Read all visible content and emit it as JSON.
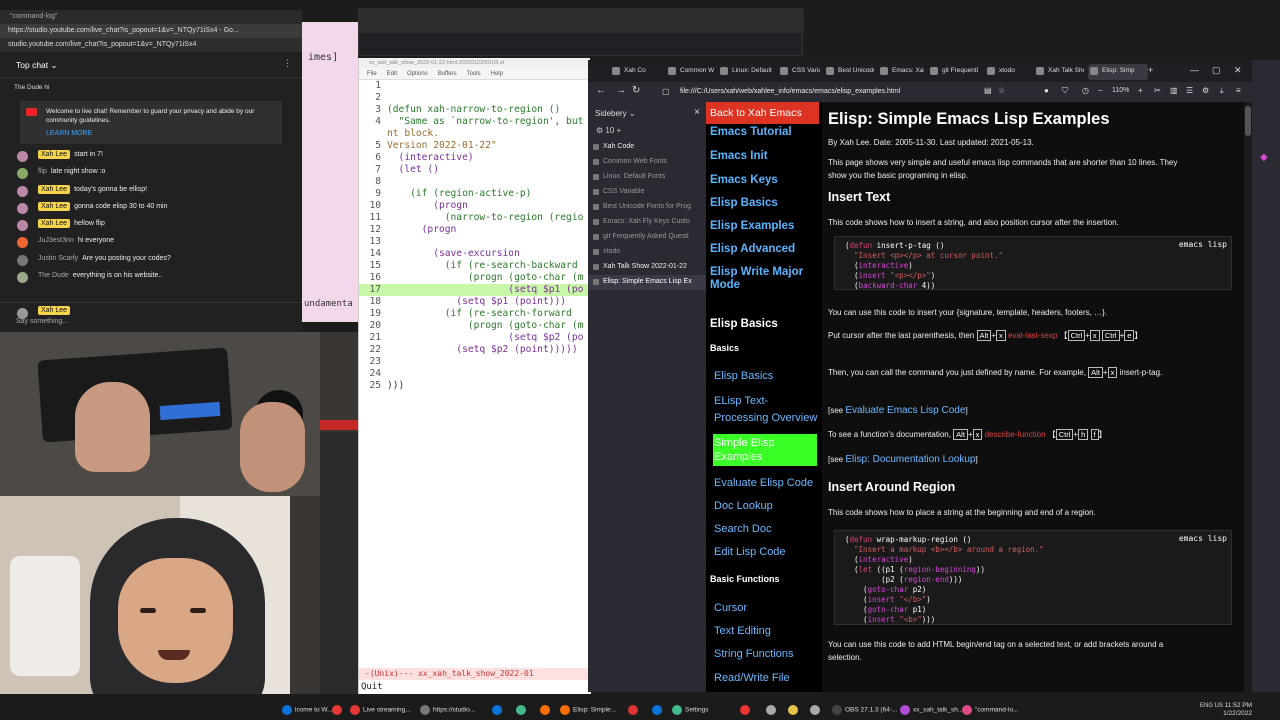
{
  "chat": {
    "window_title": "\"command-log\"",
    "url": "studio.youtube.com/live_chat?is_popout=1&v=_NTQy71iSx4",
    "url_full": "https://studio.youtube.com/live_chat?is_popout=1&v=_NTQy71iSx4 - Go...",
    "header": "Top chat",
    "pinned_name": "The Dude",
    "pinned_text": "hi",
    "welcome_text": "Welcome to live chat! Remember to guard your privacy and abide by our community guidelines.",
    "learn_more": "LEARN MORE",
    "messages": [
      {
        "name": "Xah Lee",
        "owner": true,
        "text": "start in 7!",
        "color": "#b8a"
      },
      {
        "name": "flip",
        "owner": false,
        "text": "late night show :o",
        "color": "#8a6"
      },
      {
        "name": "Xah Lee",
        "owner": true,
        "text": "today's gonna be ellisp!",
        "color": "#b8a"
      },
      {
        "name": "Xah Lee",
        "owner": true,
        "text": "gonna code elisp 30 to 40 min",
        "color": "#b8a"
      },
      {
        "name": "Xah Lee",
        "owner": true,
        "text": "hellow flip",
        "color": "#b8a"
      },
      {
        "name": "JuJ3est3nn",
        "owner": false,
        "text": "hi everyone",
        "color": "#e63"
      },
      {
        "name": "Justin Scarfy",
        "owner": false,
        "text": "Are you posting your codes?",
        "color": "#777"
      },
      {
        "name": "The Dude",
        "owner": false,
        "text": "everything is on his website..",
        "color": "#9a8"
      }
    ],
    "input_name": "Xah Lee",
    "input_placeholder": "Say something..."
  },
  "pink_window": {
    "text_top": "imes]",
    "text_bottom": "undamenta"
  },
  "emacs": {
    "title": "xx_xah_talk_show_2022-01-22.html:2022012200103.el",
    "menu": [
      "File",
      "Edit",
      "Options",
      "Buffers",
      "Tools",
      "Help"
    ],
    "lines": [
      {
        "n": "1",
        "t": ""
      },
      {
        "n": "2",
        "t": ""
      },
      {
        "n": "3",
        "t": "(defun xah-narrow-to-region ()"
      },
      {
        "n": "4",
        "t": "  \"Same as `narrow-to-region', but"
      },
      {
        "n": "",
        "t": "nt block."
      },
      {
        "n": "5",
        "t": "Version 2022-01-22\""
      },
      {
        "n": "6",
        "t": "  (interactive)"
      },
      {
        "n": "7",
        "t": "  (let ()"
      },
      {
        "n": "8",
        "t": ""
      },
      {
        "n": "9",
        "t": "    (if (region-active-p)"
      },
      {
        "n": "10",
        "t": "        (progn"
      },
      {
        "n": "11",
        "t": "          (narrow-to-region (regio"
      },
      {
        "n": "12",
        "t": "      (progn"
      },
      {
        "n": "13",
        "t": ""
      },
      {
        "n": "14",
        "t": "        (save-excursion"
      },
      {
        "n": "15",
        "t": "          (if (re-search-backward"
      },
      {
        "n": "16",
        "t": "              (progn (goto-char (m"
      },
      {
        "n": "17",
        "t": "                     (setq $p1 (po"
      },
      {
        "n": "18",
        "t": "            (setq $p1 (point)))"
      },
      {
        "n": "19",
        "t": "          (if (re-search-forward"
      },
      {
        "n": "20",
        "t": "              (progn (goto-char (m"
      },
      {
        "n": "21",
        "t": "                     (setq $p2 (po"
      },
      {
        "n": "22",
        "t": "            (setq $p2 (point)))))"
      },
      {
        "n": "23",
        "t": ""
      },
      {
        "n": "24",
        "t": ""
      },
      {
        "n": "25",
        "t": ")))"
      }
    ],
    "modeline": "-(Unix)---  xx_xah_talk_show_2022-01",
    "minibuffer": "Quit"
  },
  "firefox": {
    "tabs": [
      "Xah Co",
      "Common We",
      "Linux: Default",
      "CSS Variable",
      "Best Unicode",
      "Emacs: Xah Fi",
      "git Frequentl",
      "xtodo",
      "Xah Talk Show",
      "Elisp: Simp"
    ],
    "new_tab": "+",
    "url": "file:///C:/Users/xah/web/xahlee_info/emacs/emacs/elisp_examples.html",
    "zoom": "110%",
    "sidebery_title": "Sidebery",
    "sidebery_items": [
      {
        "label": "Xah Code",
        "state": "hi"
      },
      {
        "label": "Common Web Fonts",
        "state": ""
      },
      {
        "label": "Linux: Default Fonts",
        "state": ""
      },
      {
        "label": "CSS Variable",
        "state": ""
      },
      {
        "label": "Best Unicode Fonts for Prog",
        "state": ""
      },
      {
        "label": "Emacs: Xah Fly Keys Custo",
        "state": ""
      },
      {
        "label": "git Frequently Asked Questi",
        "state": ""
      },
      {
        "label": "xtodo",
        "state": ""
      },
      {
        "label": "Xah Talk Show 2022-01-22",
        "state": "hi"
      },
      {
        "label": "Elisp: Simple Emacs Lisp Ex",
        "state": "act"
      }
    ]
  },
  "page": {
    "back_button": "Back to Xah Emacs",
    "nav_main": [
      "Emacs Tutorial",
      "Emacs Init",
      "Emacs Keys",
      "Elisp Basics",
      "Elisp Examples",
      "Elisp Advanced",
      "Elisp Write Major Mode"
    ],
    "nav_section": "Elisp Basics",
    "nav_sub1": "Basics",
    "nav_basics": [
      "Elisp Basics",
      "ELisp Text-Processing Overview",
      "Simple Elisp Examples",
      "Evaluate Elisp Code",
      "Doc Lookup",
      "Search Doc",
      "Edit Lisp Code"
    ],
    "nav_sub2": "Basic Functions",
    "nav_funcs": [
      "Cursor",
      "Text Editing",
      "String Functions",
      "Read/Write File"
    ],
    "title": "Elisp: Simple Emacs Lisp Examples",
    "byline": "By Xah Lee. Date: 2005-11-30. Last updated: 2021-05-13.",
    "intro": "This page shows very simple and useful emacs lisp commands that are shorter than 10 lines. They show you the basic programing in elisp.",
    "h_insert_text": "Insert Text",
    "p_insert_text": "This code shows how to insert a string, and also position cursor after the insertion.",
    "code_lang": "emacs lisp",
    "p_use": "You can use this code to insert your {signature, template, headers, footers, …}.",
    "p_cursor": "Put cursor after the last parenthesis, then",
    "k_alt": "Alt",
    "k_x": "x",
    "cmd_eval": "eval-last-sexp",
    "k_ctrl": "Ctrl",
    "k_e": "e",
    "p_then": "Then, you can call the command you just defined by name. For example,",
    "cmd_insert": "insert-p-tag.",
    "see1_pre": "[see",
    "see1_link": "Evaluate Emacs Lisp Code",
    "see_post": "]",
    "p_doc": "To see a function's documentation,",
    "cmd_describe": "describe-function",
    "k_h": "h",
    "k_f": "f",
    "see2_link": "Elisp: Documentation Lookup",
    "h_insert_around": "Insert Around Region",
    "p_around": "This code shows how to place a string at the beginning and end of a region.",
    "p_html": "You can use this code to add HTML begin/end tag on a selected text, or add brackets around a selection."
  },
  "taskbar": {
    "items": [
      "lcome to W...",
      "Live streaming...",
      "https://studio...",
      "Elisp: Simple...",
      "Settings",
      "OBS 27.1.3 (64-...",
      "xx_xah_talk_sh...",
      "\"command-lo..."
    ],
    "locale": "ENG US",
    "time": "11:52 PM",
    "date": "1/22/2022"
  },
  "colors": {
    "owner_badge": "#f5d34a",
    "back_button": "#dd3322",
    "nav_selected": "#3aff26",
    "link": "#6db8ff"
  }
}
